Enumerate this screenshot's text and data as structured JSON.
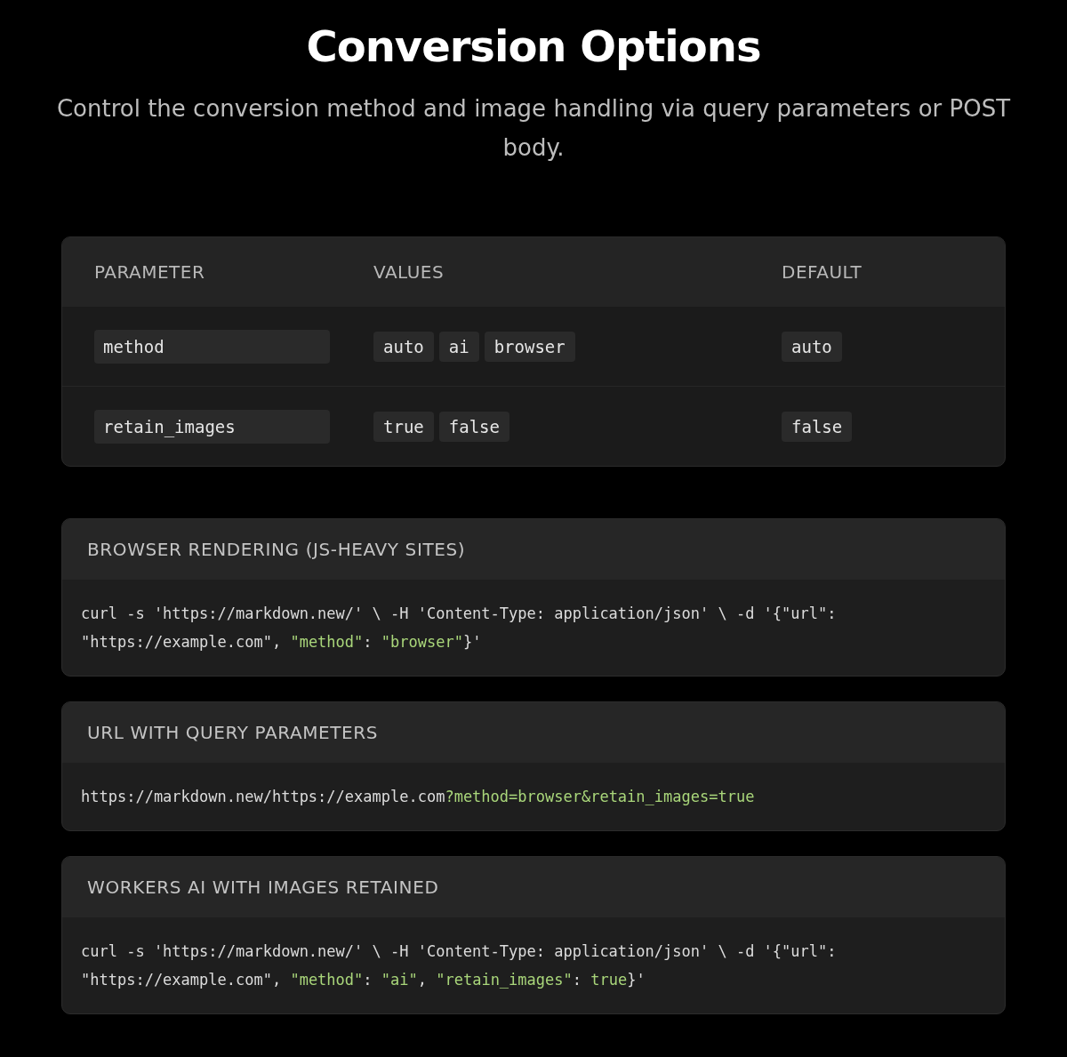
{
  "title": "Conversion Options",
  "subtitle": "Control the conversion method and image handling via query parameters or POST body.",
  "table": {
    "columns": [
      "PARAMETER",
      "VALUES",
      "DEFAULT"
    ],
    "rows": [
      {
        "parameter": "method",
        "values": [
          "auto",
          "ai",
          "browser"
        ],
        "default": "auto"
      },
      {
        "parameter": "retain_images",
        "values": [
          "true",
          "false"
        ],
        "default": "false"
      }
    ]
  },
  "examples": [
    {
      "heading": "BROWSER RENDERING (JS-HEAVY SITES)",
      "lines": [
        [
          {
            "kind": "plain",
            "text": "curl -s 'https://markdown.new/' \\ -H 'Content-Type: application/json' \\ -d '{\"url\":"
          }
        ],
        [
          {
            "kind": "plain",
            "text": "\"https://example.com\", "
          },
          {
            "kind": "highlight",
            "text": "\"method\""
          },
          {
            "kind": "plain",
            "text": ": "
          },
          {
            "kind": "highlight",
            "text": "\"browser\""
          },
          {
            "kind": "plain",
            "text": "}'"
          }
        ]
      ]
    },
    {
      "heading": "URL WITH QUERY PARAMETERS",
      "lines": [
        [
          {
            "kind": "plain",
            "text": "https://markdown.new/https://example.com"
          },
          {
            "kind": "highlight",
            "text": "?method=browser&retain_images=true"
          }
        ]
      ]
    },
    {
      "heading": "WORKERS AI WITH IMAGES RETAINED",
      "lines": [
        [
          {
            "kind": "plain",
            "text": "curl -s 'https://markdown.new/' \\ -H 'Content-Type: application/json' \\ -d '{\"url\":"
          }
        ],
        [
          {
            "kind": "plain",
            "text": "\"https://example.com\", "
          },
          {
            "kind": "highlight",
            "text": "\"method\""
          },
          {
            "kind": "plain",
            "text": ": "
          },
          {
            "kind": "highlight",
            "text": "\"ai\""
          },
          {
            "kind": "plain",
            "text": ", "
          },
          {
            "kind": "highlight",
            "text": "\"retain_images\""
          },
          {
            "kind": "plain",
            "text": ": "
          },
          {
            "kind": "highlight",
            "text": "true"
          },
          {
            "kind": "plain",
            "text": "}'"
          }
        ]
      ]
    }
  ]
}
